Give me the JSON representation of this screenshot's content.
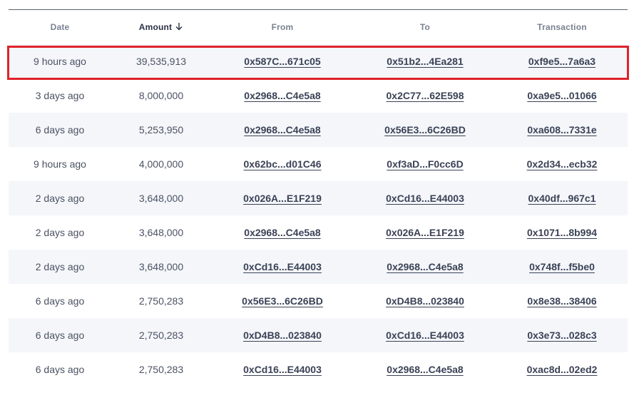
{
  "header": {
    "date": "Date",
    "amount": "Amount",
    "from": "From",
    "to": "To",
    "transaction": "Transaction"
  },
  "rows": [
    {
      "date": "9 hours ago",
      "amount": "39,535,913",
      "from": "0x587C...671c05",
      "to": "0x51b2...4Ea281",
      "tx": "0xf9e5...7a6a3"
    },
    {
      "date": "3 days ago",
      "amount": "8,000,000",
      "from": "0x2968...C4e5a8",
      "to": "0x2C77...62E598",
      "tx": "0xa9e5...01066"
    },
    {
      "date": "6 days ago",
      "amount": "5,253,950",
      "from": "0x2968...C4e5a8",
      "to": "0x56E3...6C26BD",
      "tx": "0xa608...7331e"
    },
    {
      "date": "9 hours ago",
      "amount": "4,000,000",
      "from": "0x62bc...d01C46",
      "to": "0xf3aD...F0cc6D",
      "tx": "0x2d34...ecb32"
    },
    {
      "date": "2 days ago",
      "amount": "3,648,000",
      "from": "0x026A...E1F219",
      "to": "0xCd16...E44003",
      "tx": "0x40df...967c1"
    },
    {
      "date": "2 days ago",
      "amount": "3,648,000",
      "from": "0x2968...C4e5a8",
      "to": "0x026A...E1F219",
      "tx": "0x1071...8b994"
    },
    {
      "date": "2 days ago",
      "amount": "3,648,000",
      "from": "0xCd16...E44003",
      "to": "0x2968...C4e5a8",
      "tx": "0x748f...f5be0"
    },
    {
      "date": "6 days ago",
      "amount": "2,750,283",
      "from": "0x56E3...6C26BD",
      "to": "0xD4B8...023840",
      "tx": "0x8e38...38406"
    },
    {
      "date": "6 days ago",
      "amount": "2,750,283",
      "from": "0xD4B8...023840",
      "to": "0xCd16...E44003",
      "tx": "0x3e73...028c3"
    },
    {
      "date": "6 days ago",
      "amount": "2,750,283",
      "from": "0xCd16...E44003",
      "to": "0x2968...C4e5a8",
      "tx": "0xac8d...02ed2"
    }
  ],
  "colors": {
    "highlight": "#e0222a",
    "alt_row": "#f4f6fa",
    "link": "#3a4256"
  },
  "icons": {
    "sort": "arrow-down-icon"
  }
}
